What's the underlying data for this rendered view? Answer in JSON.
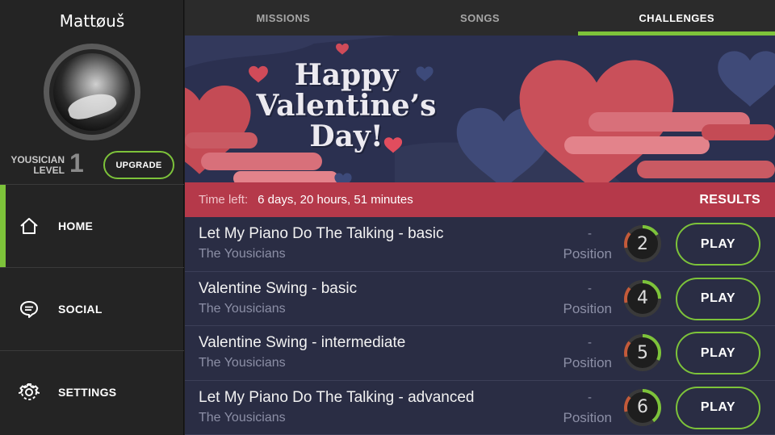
{
  "user": {
    "name": "Mattøuš",
    "level_label_line1": "YOUSICIAN",
    "level_label_line2": "LEVEL",
    "level": "1",
    "upgrade_label": "UPGRADE"
  },
  "nav": [
    {
      "label": "HOME",
      "icon": "home-icon",
      "active": true
    },
    {
      "label": "SOCIAL",
      "icon": "chat-icon",
      "active": false
    },
    {
      "label": "SETTINGS",
      "icon": "gear-icon",
      "active": false
    }
  ],
  "tabs": [
    {
      "label": "MISSIONS",
      "active": false
    },
    {
      "label": "SONGS",
      "active": false
    },
    {
      "label": "CHALLENGES",
      "active": true
    }
  ],
  "banner": {
    "line1": "Happy",
    "line2": "Valentine’s",
    "line3": "Day!"
  },
  "timebar": {
    "label": "Time left:",
    "value": "6 days, 20 hours, 51 minutes",
    "results_label": "RESULTS"
  },
  "challenges": [
    {
      "title": "Let My Piano Do The Talking - basic",
      "artist": "The Yousicians",
      "position": "-",
      "position_label": "Position",
      "level": "2",
      "play_label": "PLAY"
    },
    {
      "title": "Valentine Swing - basic",
      "artist": "The Yousicians",
      "position": "-",
      "position_label": "Position",
      "level": "4",
      "play_label": "PLAY"
    },
    {
      "title": "Valentine Swing - intermediate",
      "artist": "The Yousicians",
      "position": "-",
      "position_label": "Position",
      "level": "5",
      "play_label": "PLAY"
    },
    {
      "title": "Let My Piano Do The Talking - advanced",
      "artist": "The Yousicians",
      "position": "-",
      "position_label": "Position",
      "level": "6",
      "play_label": "PLAY"
    }
  ],
  "colors": {
    "accent": "#7dc33a",
    "banner_bg": "#2a2f4a",
    "timebar": "#b5394a",
    "list_bg": "#2a2d44",
    "sidebar_bg": "#242424"
  }
}
